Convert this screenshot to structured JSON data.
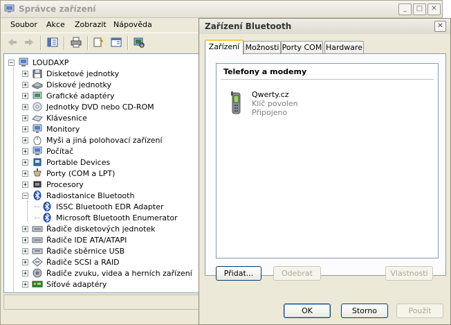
{
  "device_manager": {
    "title": "Správce zařízení",
    "menu": [
      "Soubor",
      "Akce",
      "Zobrazit",
      "Nápověda"
    ],
    "root": "LOUDAXP",
    "tree": [
      {
        "label": "Disketové jednotky",
        "icon": "floppy-icon",
        "expander": "+"
      },
      {
        "label": "Diskové jednotky",
        "icon": "disk-icon",
        "expander": "+"
      },
      {
        "label": "Grafické adaptéry",
        "icon": "display-adapter-icon",
        "expander": "+"
      },
      {
        "label": "Jednotky DVD nebo CD-ROM",
        "icon": "cdrom-icon",
        "expander": "+"
      },
      {
        "label": "Klávesnice",
        "icon": "keyboard-icon",
        "expander": "+"
      },
      {
        "label": "Monitory",
        "icon": "monitor-icon",
        "expander": "+"
      },
      {
        "label": "Myši a jiná polohovací zařízení",
        "icon": "mouse-icon",
        "expander": "+"
      },
      {
        "label": "Počítač",
        "icon": "computer-icon",
        "expander": "+"
      },
      {
        "label": "Portable Devices",
        "icon": "portable-device-icon",
        "expander": "+"
      },
      {
        "label": "Porty (COM a LPT)",
        "icon": "port-icon",
        "expander": "+"
      },
      {
        "label": "Procesory",
        "icon": "processor-icon",
        "expander": "+"
      },
      {
        "label": "Radiostanice Bluetooth",
        "icon": "bluetooth-icon",
        "expander": "-"
      },
      {
        "label": "ISSC Bluetooth EDR Adapter",
        "icon": "bluetooth-icon",
        "child": true
      },
      {
        "label": "Microsoft Bluetooth Enumerator",
        "icon": "bluetooth-icon",
        "child": true
      },
      {
        "label": "Řadiče disketových jednotek",
        "icon": "controller-icon",
        "expander": "+"
      },
      {
        "label": "Řadiče IDE ATA/ATAPI",
        "icon": "controller-icon",
        "expander": "+"
      },
      {
        "label": "Řadiče sběrnice USB",
        "icon": "usb-icon",
        "expander": "+"
      },
      {
        "label": "Řadiče SCSI a RAID",
        "icon": "scsi-icon",
        "expander": "+"
      },
      {
        "label": "Řadiče zvuku, videa a herních zařízení",
        "icon": "sound-icon",
        "expander": "+"
      },
      {
        "label": "Síťové adaptéry",
        "icon": "network-icon",
        "expander": "+"
      }
    ]
  },
  "bluetooth_dialog": {
    "title": "Zařízení Bluetooth",
    "tabs": [
      "Zařízení",
      "Možnosti",
      "Porty COM",
      "Hardware"
    ],
    "group": "Telefony a modemy",
    "device": {
      "name": "Qwerty.cz",
      "line2": "Klíč povolen",
      "line3": "Připojeno"
    },
    "buttons": {
      "add": "Přidat...",
      "remove": "Odebrat",
      "properties": "Vlastnosti"
    },
    "footer": {
      "ok": "OK",
      "cancel": "Storno",
      "apply": "Použít"
    }
  },
  "colors": {
    "selection_tab": "#ffc83c",
    "window_bg": "#ece9d8",
    "list_border": "#7f9db9"
  }
}
